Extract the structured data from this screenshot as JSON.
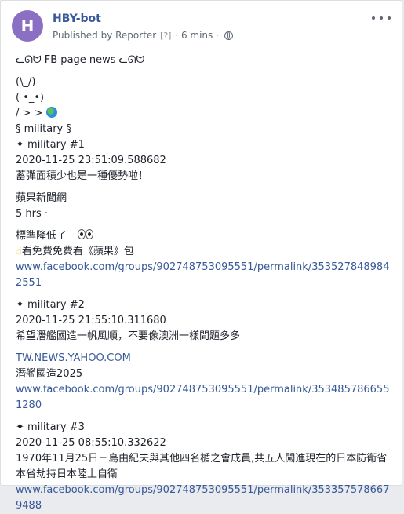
{
  "post": {
    "avatar_letter": "H",
    "author": "HBY-bot",
    "published_by": "Published by Reporter",
    "reporter_hint": "[?]",
    "time_ago": "6 mins",
    "separator": "·",
    "privacy_icon": "globe-icon",
    "more_icon": "more-options-icon"
  },
  "header_line": "ᓚᘏᗢ FB page news ᓚᘏᗢ",
  "ascii_art": [
    "(\\_/)",
    "( •_•)",
    "/ > >"
  ],
  "section_title": "§ military §",
  "items": [
    {
      "title": "✦ military #1",
      "timestamp": "2020-11-25 23:51:09.588682",
      "text": "蓄彈面積少也是一種優勢啦！",
      "source": "蘋果新聞網",
      "source_time": "5 hrs ·",
      "note1": "標準降低了",
      "note2": "看免費免費看《蘋果》包",
      "link": "www.facebook.com/groups/902748753095551/permalink/3535278489842551"
    },
    {
      "title": "✦ military #2",
      "timestamp": "2020-11-25 21:55:10.311680",
      "text": "希望潛艦國造一帆風順，不要像澳洲一樣問題多多",
      "source_link": "TW.NEWS.YAHOO.COM",
      "headline": "潛艦國造2025",
      "link": "www.facebook.com/groups/902748753095551/permalink/3534857866551280"
    },
    {
      "title": "✦ military #3",
      "timestamp": "2020-11-25 08:55:10.332622",
      "text": "1970年11月25日三島由紀夫與其他四名楯之會成員,共五人闖進現在的日本防衛省本省劫持日本陸上自衛",
      "link": "www.facebook.com/groups/902748753095551/permalink/3533575786679488"
    }
  ]
}
